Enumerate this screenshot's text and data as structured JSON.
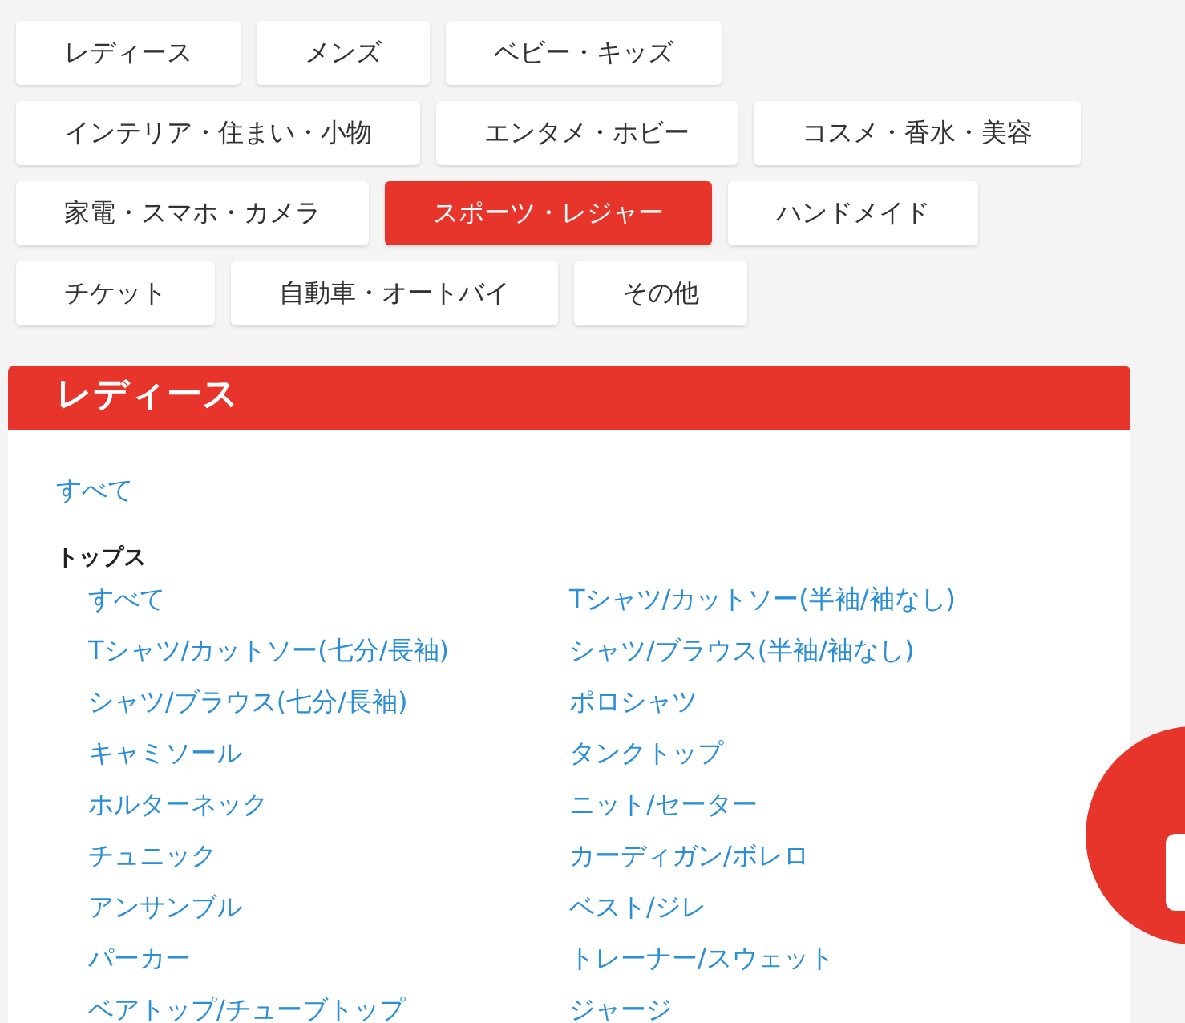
{
  "category_rows": [
    [
      {
        "label": "レディース",
        "selected": false
      },
      {
        "label": "メンズ",
        "selected": false
      },
      {
        "label": "ベビー・キッズ",
        "selected": false
      }
    ],
    [
      {
        "label": "インテリア・住まい・小物",
        "selected": false
      },
      {
        "label": "エンタメ・ホビー",
        "selected": false
      },
      {
        "label": "コスメ・香水・美容",
        "selected": false
      }
    ],
    [
      {
        "label": "家電・スマホ・カメラ",
        "selected": false
      },
      {
        "label": "スポーツ・レジャー",
        "selected": true
      },
      {
        "label": "ハンドメイド",
        "selected": false
      }
    ],
    [
      {
        "label": "チケット",
        "selected": false
      },
      {
        "label": "自動車・オートバイ",
        "selected": false
      },
      {
        "label": "その他",
        "selected": false
      }
    ]
  ],
  "panel": {
    "title": "レディース",
    "all_link": "すべて",
    "groups": [
      {
        "heading": "トップス",
        "items": [
          "すべて",
          "Tシャツ/カットソー(半袖/袖なし)",
          "Tシャツ/カットソー(七分/長袖)",
          "シャツ/ブラウス(半袖/袖なし)",
          "シャツ/ブラウス(七分/長袖)",
          "ポロシャツ",
          "キャミソール",
          "タンクトップ",
          "ホルターネック",
          "ニット/セーター",
          "チュニック",
          "カーディガン/ボレロ",
          "アンサンブル",
          "ベスト/ジレ",
          "パーカー",
          "トレーナー/スウェット",
          "ベアトップ/チューブトップ",
          "ジャージ"
        ]
      }
    ]
  }
}
